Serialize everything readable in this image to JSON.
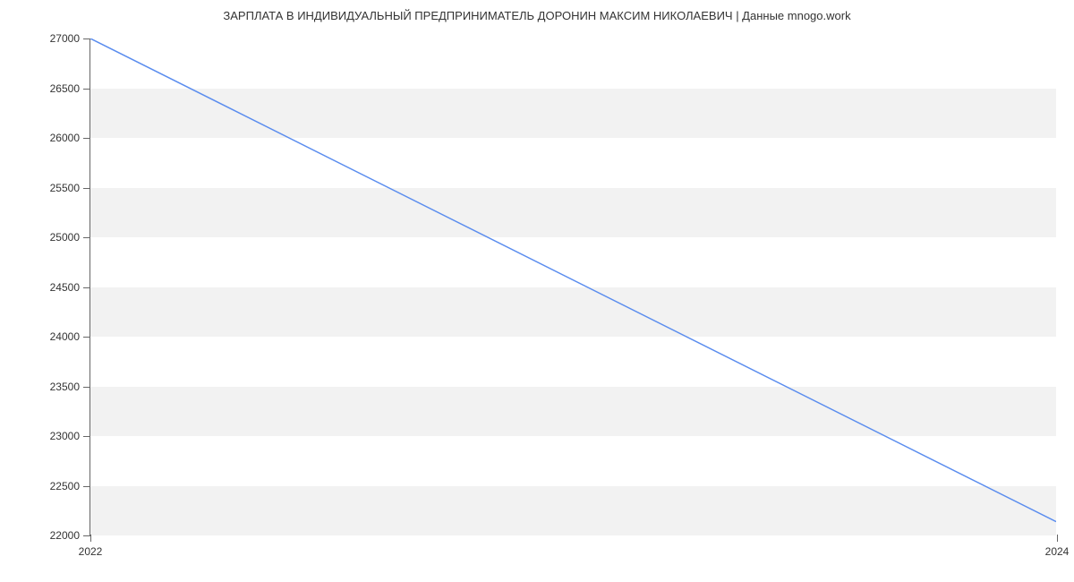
{
  "chart_data": {
    "type": "line",
    "title": "ЗАРПЛАТА В ИНДИВИДУАЛЬНЫЙ ПРЕДПРИНИМАТЕЛЬ ДОРОНИН МАКСИМ НИКОЛАЕВИЧ | Данные mnogo.work",
    "x": [
      2022,
      2024
    ],
    "values": [
      27000,
      22130
    ],
    "xlabel": "",
    "ylabel": "",
    "xlim": [
      2022,
      2024
    ],
    "ylim": [
      22000,
      27000
    ],
    "y_ticks": [
      22000,
      22500,
      23000,
      23500,
      24000,
      24500,
      25000,
      25500,
      26000,
      26500,
      27000
    ],
    "x_ticks": [
      2022,
      2024
    ],
    "line_color": "#5b8def"
  }
}
